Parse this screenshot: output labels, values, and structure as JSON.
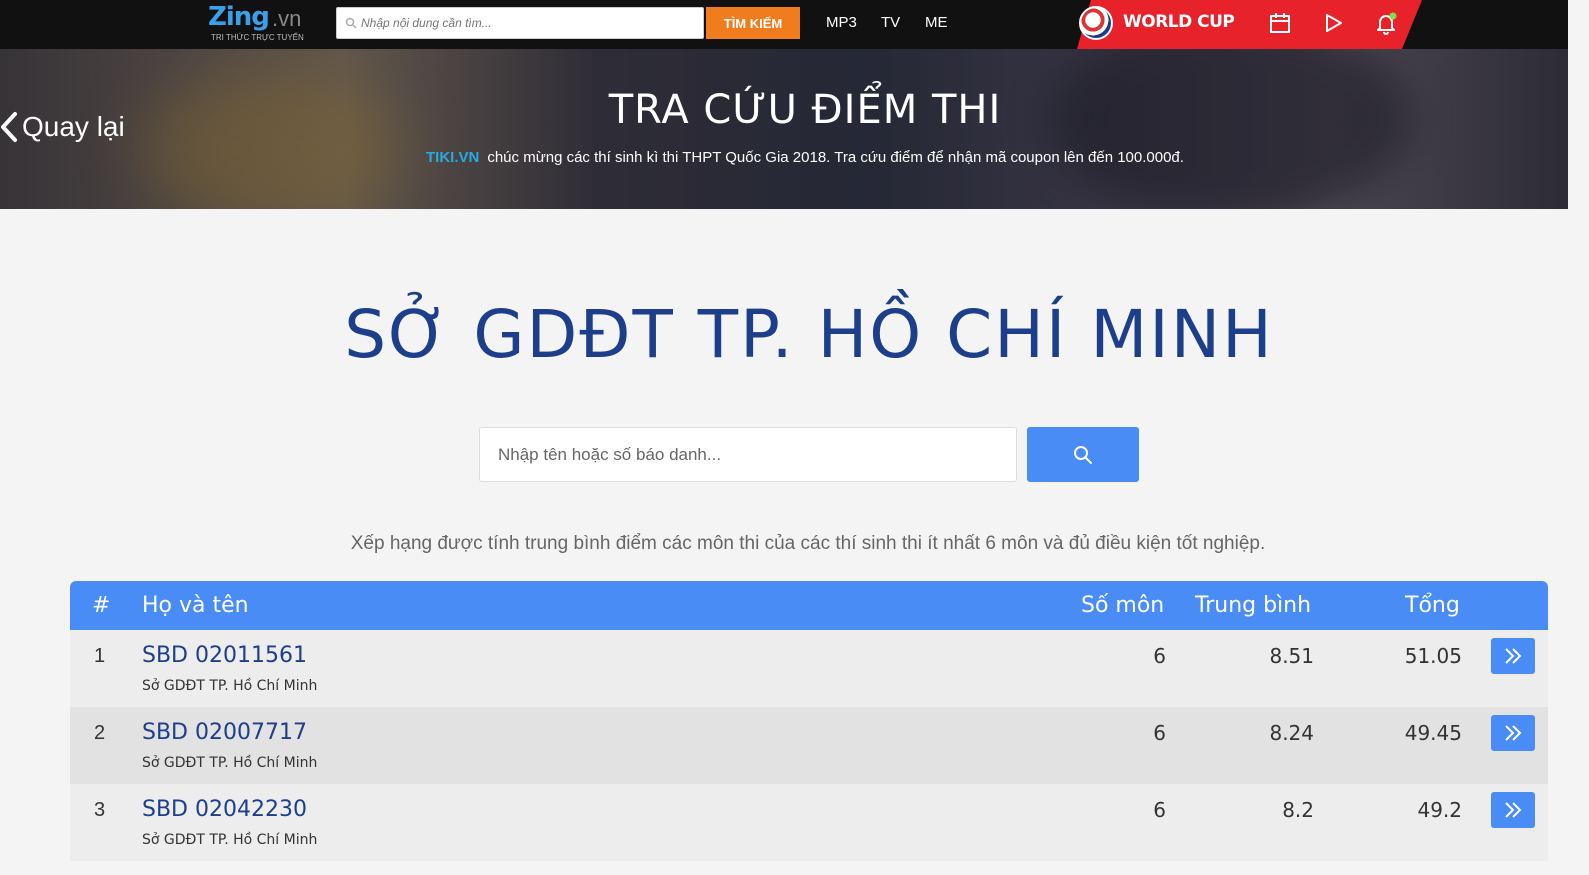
{
  "topbar": {
    "logo_main": "Zing",
    "logo_tld": ".vn",
    "logo_tagline": "TRI THỨC TRỰC TUYẾN",
    "search_placeholder": "Nhập nội dung cần tìm...",
    "search_button": "TÌM KIẾM",
    "nav": [
      "MP3",
      "TV",
      "ME"
    ],
    "worldcup_label": "WORLD CUP"
  },
  "hero": {
    "back_label": "Quay lại",
    "title": "TRA CỨU ĐIỂM THI",
    "sponsor": "TIKI.VN",
    "subtitle": "chúc mừng các thí sinh kì thi THPT Quốc Gia 2018. Tra cứu điểm để nhận mã coupon lên đến 100.000đ."
  },
  "main": {
    "region_title": "SỞ GDĐT TP. HỒ CHÍ MINH",
    "search_placeholder": "Nhập tên hoặc số báo danh...",
    "rank_note": "Xếp hạng được tính trung bình điểm các môn thi của các thí sinh thi ít nhất 6 môn và đủ điều kiện tốt nghiệp."
  },
  "table": {
    "headers": {
      "rank": "#",
      "name": "Họ và tên",
      "subjects": "Số môn",
      "average": "Trung bình",
      "total": "Tổng"
    },
    "rows": [
      {
        "rank": "1",
        "sbd": "SBD 02011561",
        "dept": "Sở GDĐT TP. Hồ Chí Minh",
        "subjects": "6",
        "average": "8.51",
        "total": "51.05"
      },
      {
        "rank": "2",
        "sbd": "SBD 02007717",
        "dept": "Sở GDĐT TP. Hồ Chí Minh",
        "subjects": "6",
        "average": "8.24",
        "total": "49.45"
      },
      {
        "rank": "3",
        "sbd": "SBD 02042230",
        "dept": "Sở GDĐT TP. Hồ Chí Minh",
        "subjects": "6",
        "average": "8.2",
        "total": "49.2"
      }
    ]
  },
  "colors": {
    "accent_blue": "#4a8cf5",
    "title_navy": "#1d3e8a",
    "search_orange": "#f07c1e",
    "worldcup_red": "#e8222a"
  }
}
